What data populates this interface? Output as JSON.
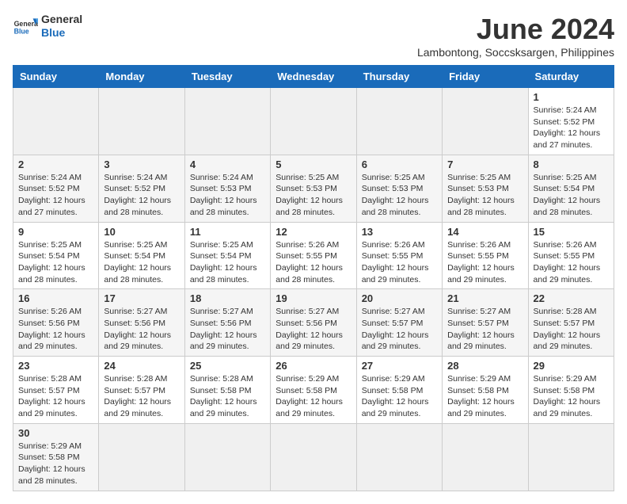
{
  "header": {
    "logo_general": "General",
    "logo_blue": "Blue",
    "title": "June 2024",
    "subtitle": "Lambontong, Soccsksargen, Philippines"
  },
  "weekdays": [
    "Sunday",
    "Monday",
    "Tuesday",
    "Wednesday",
    "Thursday",
    "Friday",
    "Saturday"
  ],
  "weeks": [
    [
      {
        "day": "",
        "info": ""
      },
      {
        "day": "",
        "info": ""
      },
      {
        "day": "",
        "info": ""
      },
      {
        "day": "",
        "info": ""
      },
      {
        "day": "",
        "info": ""
      },
      {
        "day": "",
        "info": ""
      },
      {
        "day": "1",
        "info": "Sunrise: 5:24 AM\nSunset: 5:52 PM\nDaylight: 12 hours\nand 27 minutes."
      }
    ],
    [
      {
        "day": "2",
        "info": "Sunrise: 5:24 AM\nSunset: 5:52 PM\nDaylight: 12 hours\nand 27 minutes."
      },
      {
        "day": "3",
        "info": "Sunrise: 5:24 AM\nSunset: 5:52 PM\nDaylight: 12 hours\nand 28 minutes."
      },
      {
        "day": "4",
        "info": "Sunrise: 5:24 AM\nSunset: 5:53 PM\nDaylight: 12 hours\nand 28 minutes."
      },
      {
        "day": "5",
        "info": "Sunrise: 5:25 AM\nSunset: 5:53 PM\nDaylight: 12 hours\nand 28 minutes."
      },
      {
        "day": "6",
        "info": "Sunrise: 5:25 AM\nSunset: 5:53 PM\nDaylight: 12 hours\nand 28 minutes."
      },
      {
        "day": "7",
        "info": "Sunrise: 5:25 AM\nSunset: 5:53 PM\nDaylight: 12 hours\nand 28 minutes."
      },
      {
        "day": "8",
        "info": "Sunrise: 5:25 AM\nSunset: 5:54 PM\nDaylight: 12 hours\nand 28 minutes."
      }
    ],
    [
      {
        "day": "9",
        "info": "Sunrise: 5:25 AM\nSunset: 5:54 PM\nDaylight: 12 hours\nand 28 minutes."
      },
      {
        "day": "10",
        "info": "Sunrise: 5:25 AM\nSunset: 5:54 PM\nDaylight: 12 hours\nand 28 minutes."
      },
      {
        "day": "11",
        "info": "Sunrise: 5:25 AM\nSunset: 5:54 PM\nDaylight: 12 hours\nand 28 minutes."
      },
      {
        "day": "12",
        "info": "Sunrise: 5:26 AM\nSunset: 5:55 PM\nDaylight: 12 hours\nand 28 minutes."
      },
      {
        "day": "13",
        "info": "Sunrise: 5:26 AM\nSunset: 5:55 PM\nDaylight: 12 hours\nand 29 minutes."
      },
      {
        "day": "14",
        "info": "Sunrise: 5:26 AM\nSunset: 5:55 PM\nDaylight: 12 hours\nand 29 minutes."
      },
      {
        "day": "15",
        "info": "Sunrise: 5:26 AM\nSunset: 5:55 PM\nDaylight: 12 hours\nand 29 minutes."
      }
    ],
    [
      {
        "day": "16",
        "info": "Sunrise: 5:26 AM\nSunset: 5:56 PM\nDaylight: 12 hours\nand 29 minutes."
      },
      {
        "day": "17",
        "info": "Sunrise: 5:27 AM\nSunset: 5:56 PM\nDaylight: 12 hours\nand 29 minutes."
      },
      {
        "day": "18",
        "info": "Sunrise: 5:27 AM\nSunset: 5:56 PM\nDaylight: 12 hours\nand 29 minutes."
      },
      {
        "day": "19",
        "info": "Sunrise: 5:27 AM\nSunset: 5:56 PM\nDaylight: 12 hours\nand 29 minutes."
      },
      {
        "day": "20",
        "info": "Sunrise: 5:27 AM\nSunset: 5:57 PM\nDaylight: 12 hours\nand 29 minutes."
      },
      {
        "day": "21",
        "info": "Sunrise: 5:27 AM\nSunset: 5:57 PM\nDaylight: 12 hours\nand 29 minutes."
      },
      {
        "day": "22",
        "info": "Sunrise: 5:28 AM\nSunset: 5:57 PM\nDaylight: 12 hours\nand 29 minutes."
      }
    ],
    [
      {
        "day": "23",
        "info": "Sunrise: 5:28 AM\nSunset: 5:57 PM\nDaylight: 12 hours\nand 29 minutes."
      },
      {
        "day": "24",
        "info": "Sunrise: 5:28 AM\nSunset: 5:57 PM\nDaylight: 12 hours\nand 29 minutes."
      },
      {
        "day": "25",
        "info": "Sunrise: 5:28 AM\nSunset: 5:58 PM\nDaylight: 12 hours\nand 29 minutes."
      },
      {
        "day": "26",
        "info": "Sunrise: 5:29 AM\nSunset: 5:58 PM\nDaylight: 12 hours\nand 29 minutes."
      },
      {
        "day": "27",
        "info": "Sunrise: 5:29 AM\nSunset: 5:58 PM\nDaylight: 12 hours\nand 29 minutes."
      },
      {
        "day": "28",
        "info": "Sunrise: 5:29 AM\nSunset: 5:58 PM\nDaylight: 12 hours\nand 29 minutes."
      },
      {
        "day": "29",
        "info": "Sunrise: 5:29 AM\nSunset: 5:58 PM\nDaylight: 12 hours\nand 29 minutes."
      }
    ],
    [
      {
        "day": "30",
        "info": "Sunrise: 5:29 AM\nSunset: 5:58 PM\nDaylight: 12 hours\nand 28 minutes."
      },
      {
        "day": "",
        "info": ""
      },
      {
        "day": "",
        "info": ""
      },
      {
        "day": "",
        "info": ""
      },
      {
        "day": "",
        "info": ""
      },
      {
        "day": "",
        "info": ""
      },
      {
        "day": "",
        "info": ""
      }
    ]
  ]
}
